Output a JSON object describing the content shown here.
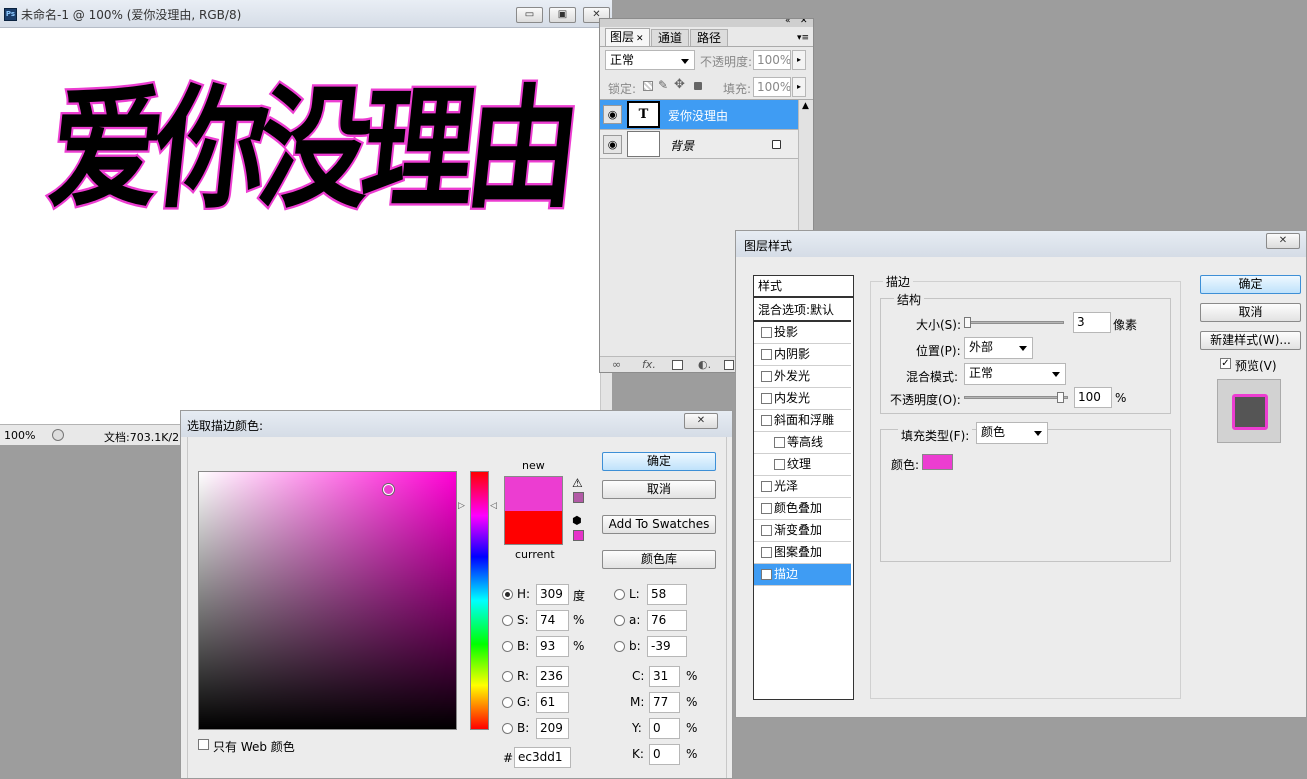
{
  "document": {
    "title": "未命名-1 @ 100% (爱你没理由, RGB/8)",
    "canvas_text": "爱你没理由",
    "text_color": "#000000",
    "stroke_color": "#ec3dd1",
    "zoom": "100%",
    "doc_info": "文档:703.1K/2",
    "buttons": {
      "minimize": "▭",
      "restore": "▣",
      "close": "✕"
    }
  },
  "layers_panel": {
    "tabs": [
      "图层",
      "通道",
      "路径"
    ],
    "blend_mode": "正常",
    "opacity_label": "不透明度:",
    "opacity": "100%",
    "lock_label": "锁定:",
    "fill_label": "填充:",
    "fill": "100%",
    "layers": [
      {
        "name": "爱你没理由",
        "thumb": "T",
        "selected": true
      },
      {
        "name": "背景",
        "thumb": "",
        "selected": false
      }
    ],
    "bottom_icons": [
      "link-icon",
      "fx-icon",
      "mask-icon",
      "adjustment-icon",
      "group-icon"
    ]
  },
  "color_picker": {
    "title": "选取描边颜色:",
    "new_label": "new",
    "current_label": "current",
    "new_color": "#ec3dd1",
    "current_color": "#ff0000",
    "ok": "确定",
    "cancel": "取消",
    "add_swatches": "Add To Swatches",
    "color_libraries": "颜色库",
    "fields": {
      "H": {
        "label": "H:",
        "value": "309",
        "unit": "度"
      },
      "S": {
        "label": "S:",
        "value": "74",
        "unit": "%"
      },
      "Bv": {
        "label": "B:",
        "value": "93",
        "unit": "%"
      },
      "R": {
        "label": "R:",
        "value": "236"
      },
      "G": {
        "label": "G:",
        "value": "61"
      },
      "Bl": {
        "label": "B:",
        "value": "209"
      },
      "L": {
        "label": "L:",
        "value": "58"
      },
      "a": {
        "label": "a:",
        "value": "76"
      },
      "b": {
        "label": "b:",
        "value": "-39"
      },
      "C": {
        "label": "C:",
        "value": "31",
        "unit": "%"
      },
      "M": {
        "label": "M:",
        "value": "77",
        "unit": "%"
      },
      "Y": {
        "label": "Y:",
        "value": "0",
        "unit": "%"
      },
      "K": {
        "label": "K:",
        "value": "0",
        "unit": "%"
      }
    },
    "hex_label": "#",
    "hex": "ec3dd1",
    "web_only": "只有 Web 颜色",
    "warning_swatch": "#b25aa6",
    "cube_swatch": "#e633c9"
  },
  "layer_style": {
    "title": "图层样式",
    "list_header": "样式",
    "items": [
      {
        "label": "混合选项:默认",
        "check": false,
        "indent": false,
        "blend": true
      },
      {
        "label": "投影",
        "check": true,
        "checked": false,
        "indent": false
      },
      {
        "label": "内阴影",
        "check": true,
        "checked": false,
        "indent": false
      },
      {
        "label": "外发光",
        "check": true,
        "checked": false,
        "indent": false
      },
      {
        "label": "内发光",
        "check": true,
        "checked": false,
        "indent": false
      },
      {
        "label": "斜面和浮雕",
        "check": true,
        "checked": false,
        "indent": false
      },
      {
        "label": "等高线",
        "check": true,
        "checked": false,
        "indent": true
      },
      {
        "label": "纹理",
        "check": true,
        "checked": false,
        "indent": true
      },
      {
        "label": "光泽",
        "check": true,
        "checked": false,
        "indent": false
      },
      {
        "label": "颜色叠加",
        "check": true,
        "checked": false,
        "indent": false
      },
      {
        "label": "渐变叠加",
        "check": true,
        "checked": false,
        "indent": false
      },
      {
        "label": "图案叠加",
        "check": true,
        "checked": false,
        "indent": false
      },
      {
        "label": "描边",
        "check": true,
        "checked": true,
        "indent": false,
        "selected": true
      }
    ],
    "section_title": "描边",
    "structure_title": "结构",
    "size_label": "大小(S):",
    "size_value": "3",
    "size_unit": "像素",
    "position_label": "位置(P):",
    "position_value": "外部",
    "blend_label": "混合模式:",
    "blend_value": "正常",
    "opacity_label": "不透明度(O):",
    "opacity_value": "100",
    "opacity_unit": "%",
    "opacity_level": 1.0,
    "size_level": 0.02,
    "fill_type_label": "填充类型(F):",
    "fill_type_value": "颜色",
    "color_label": "颜色:",
    "stroke_color": "#ec3dd1",
    "ok": "确定",
    "cancel": "取消",
    "new_style": "新建样式(W)...",
    "preview_label": "预览(V)",
    "preview_checked": true
  }
}
